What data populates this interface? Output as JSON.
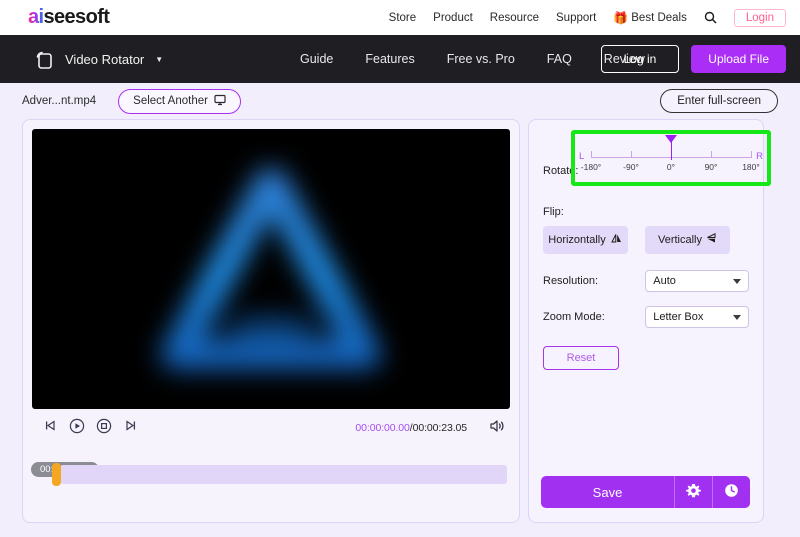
{
  "top_header": {
    "logo_ai": "ai",
    "logo_rest": "seesoft",
    "nav": [
      {
        "label": "Store",
        "name": "nav-store"
      },
      {
        "label": "Product",
        "name": "nav-product"
      },
      {
        "label": "Resource",
        "name": "nav-resource"
      },
      {
        "label": "Support",
        "name": "nav-support"
      }
    ],
    "best_deals": "Best Deals",
    "gift_icon": "gift-icon",
    "search_icon": "search-icon",
    "login_label": "Login",
    "login_color": "#ff5f8f"
  },
  "dark_nav": {
    "app_icon": "rotate-square-icon",
    "app_title": "Video Rotator",
    "caret_icon": "chevron-down-icon",
    "links": [
      {
        "label": "Guide",
        "name": "nav-guide"
      },
      {
        "label": "Features",
        "name": "nav-features"
      },
      {
        "label": "Free vs. Pro",
        "name": "nav-free-vs-pro"
      },
      {
        "label": "FAQ",
        "name": "nav-faq"
      },
      {
        "label": "Review",
        "name": "nav-review"
      }
    ],
    "login_label": "Log in",
    "upload_label": "Upload File",
    "upload_color": "#aa2ef5",
    "bg_color": "#1f1f23"
  },
  "file_bar": {
    "file_name": "Adver...nt.mp4",
    "select_another_label": "Select Another",
    "select_another_icon": "monitor-icon",
    "fullscreen_label": "Enter full-screen"
  },
  "player": {
    "controls": [
      {
        "name": "previous-frame-button",
        "icon": "step-backward-icon"
      },
      {
        "name": "play-button",
        "icon": "play-circle-icon"
      },
      {
        "name": "stop-button",
        "icon": "stop-circle-icon"
      },
      {
        "name": "next-frame-button",
        "icon": "step-forward-icon"
      }
    ],
    "current_time": "00:00:00.00",
    "separator": "/",
    "total_time": "00:00:23.05",
    "volume_icon": "speaker-icon",
    "timeline_chip": "00:00:00.00",
    "playhead_color": "#f5a623"
  },
  "panel": {
    "rotate_label": "Rotate:",
    "rotate": {
      "left_label": "L",
      "right_label": "R",
      "ticks": [
        "-180°",
        "-90°",
        "0°",
        "90°",
        "180°"
      ],
      "value_deg": 0,
      "min_deg": -180,
      "max_deg": 180,
      "highlight_color": "#16e716",
      "accent_color": "#a020f0"
    },
    "flip_label": "Flip:",
    "flip_horizontal_label": "Horizontally",
    "flip_horizontal_icon": "flip-horizontal-icon",
    "flip_vertical_label": "Vertically",
    "flip_vertical_icon": "flip-vertical-icon",
    "resolution_label": "Resolution:",
    "resolution_value": "Auto",
    "zoom_mode_label": "Zoom Mode:",
    "zoom_mode_value": "Letter Box",
    "reset_label": "Reset",
    "save_label": "Save",
    "settings_icon": "gear-icon",
    "history_icon": "clock-icon"
  }
}
